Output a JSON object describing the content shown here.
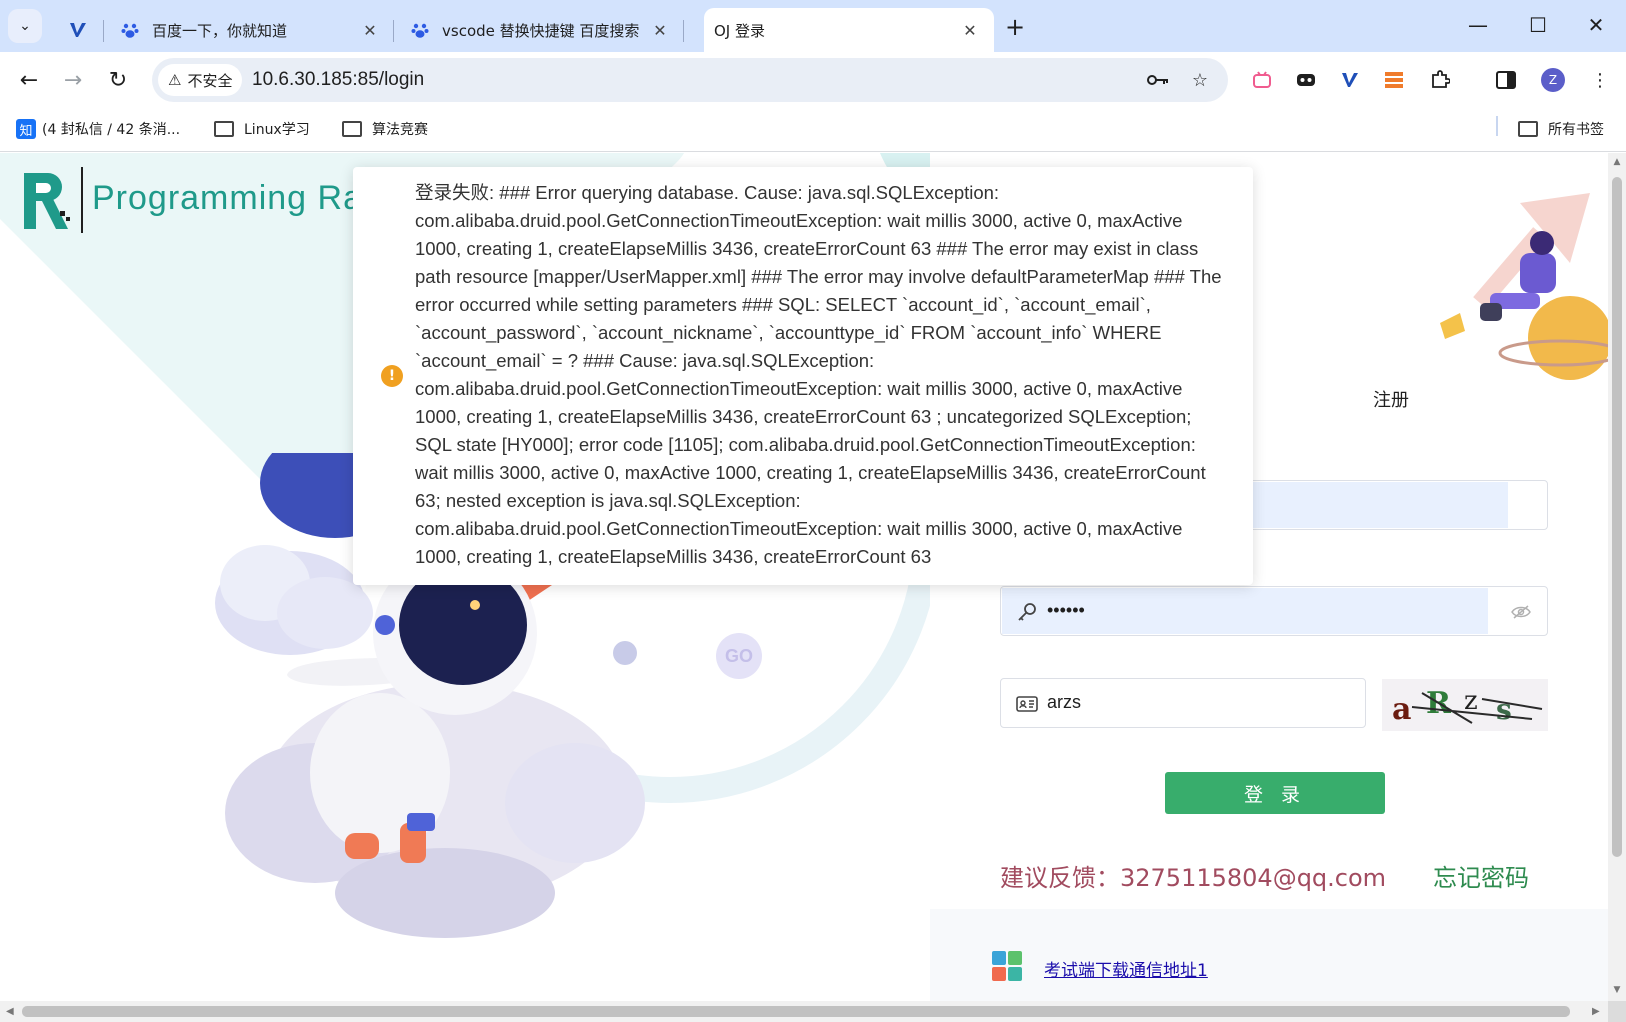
{
  "browser": {
    "tabs": [
      {
        "title": "",
        "favicon": "vscode-icon"
      },
      {
        "title": "百度一下，你就知道",
        "favicon": "baidu-paw-icon"
      },
      {
        "title": "vscode 替换快捷键 百度搜索",
        "favicon": "baidu-paw-icon"
      },
      {
        "title": "OJ 登录",
        "favicon": "",
        "active": true
      }
    ],
    "url": "10.6.30.185:85/login",
    "security_label": "不安全",
    "profile_initial": "Z",
    "bookmarks": [
      {
        "label": "(4 封私信 / 42 条消...",
        "icon": "zhihu-icon",
        "icon_text": "知"
      },
      {
        "label": "Linux学习",
        "icon": "folder-icon"
      },
      {
        "label": "算法竞赛",
        "icon": "folder-icon"
      }
    ],
    "all_bookmarks": "所有书签"
  },
  "page": {
    "brand": "Programming Ra",
    "go_badge": "GO",
    "register_tab": "注册",
    "password_mask": "••••••",
    "captcha_value": "arzs",
    "captcha_image_text": "aRzs",
    "login_button": "登 录",
    "feedback": "建议反馈：3275115804@qq.com",
    "forgot_password": "忘记密码",
    "download_link": "考试端下载通信地址1"
  },
  "error_message": {
    "icon": "!",
    "text": "登录失败: ### Error querying database. Cause: java.sql.SQLException: com.alibaba.druid.pool.GetConnectionTimeoutException: wait millis 3000, active 0, maxActive 1000, creating 1, createElapseMillis 3436, createErrorCount 63 ### The error may exist in class path resource [mapper/UserMapper.xml] ### The error may involve defaultParameterMap ### The error occurred while setting parameters ### SQL: SELECT `account_id`, `account_email`, `account_password`, `account_nickname`, `accounttype_id` FROM `account_info` WHERE `account_email` = ? ### Cause: java.sql.SQLException: com.alibaba.druid.pool.GetConnectionTimeoutException: wait millis 3000, active 0, maxActive 1000, creating 1, createElapseMillis 3436, createErrorCount 63 ; uncategorized SQLException; SQL state [HY000]; error code [1105]; com.alibaba.druid.pool.GetConnectionTimeoutException: wait millis 3000, active 0, maxActive 1000, creating 1, createElapseMillis 3436, createErrorCount 63; nested exception is java.sql.SQLException: com.alibaba.druid.pool.GetConnectionTimeoutException: wait millis 3000, active 0, maxActive 1000, creating 1, createElapseMillis 3436, createErrorCount 63"
  },
  "colors": {
    "brand": "#1f9a8a",
    "login_button": "#38ad6c",
    "feedback": "#a14b5f",
    "forgot": "#2e8b4f",
    "warning": "#f0a020"
  }
}
